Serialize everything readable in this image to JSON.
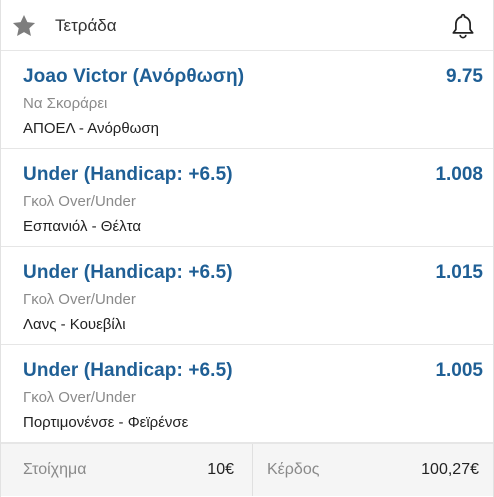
{
  "header": {
    "day": "Τετράδα",
    "star_icon": "star-icon",
    "bell_icon": "bell-icon"
  },
  "bets": [
    {
      "selection": "Joao Victor (Ανόρθωση)",
      "odds": "9.75",
      "market": "Να Σκοράρει",
      "match": "ΑΠΟΕΛ - Ανόρθωση"
    },
    {
      "selection": "Under (Handicap: +6.5)",
      "odds": "1.008",
      "market": "Γκολ Over/Under",
      "match": "Εσπανιόλ - Θέλτα"
    },
    {
      "selection": "Under (Handicap: +6.5)",
      "odds": "1.015",
      "market": "Γκολ Over/Under",
      "match": "Λανς - Κουεβίλι"
    },
    {
      "selection": "Under (Handicap: +6.5)",
      "odds": "1.005",
      "market": "Γκολ Over/Under",
      "match": "Πορτιμονένσε - Φεϊρένσε"
    }
  ],
  "footer": {
    "stake_label": "Στοίχημα",
    "stake_value": "10€",
    "return_label": "Κέρδος",
    "return_value": "100,27€"
  },
  "colors": {
    "accent": "#1f5f95",
    "muted": "#8a8a8a",
    "star": "#7d7d7d"
  }
}
